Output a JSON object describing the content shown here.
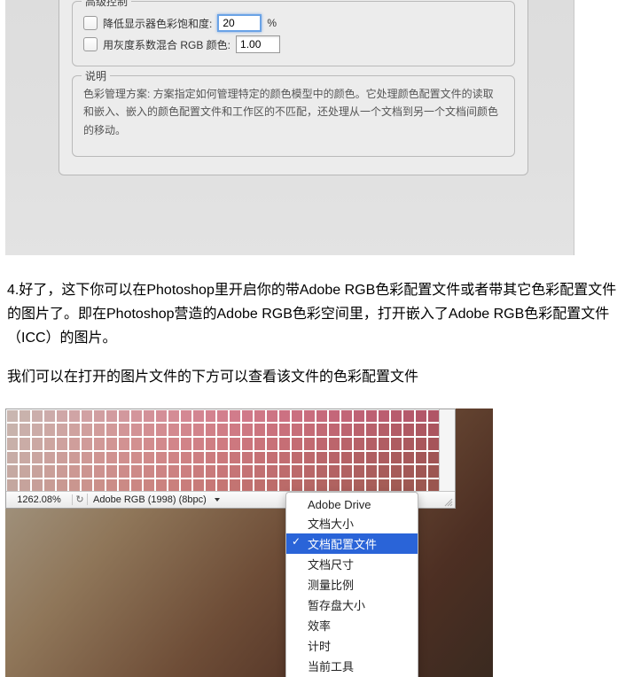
{
  "dialog": {
    "adv_legend": "高级控制",
    "cb1_label": "降低显示器色彩饱和度:",
    "cb1_value": "20",
    "cb1_unit": "%",
    "cb2_label": "用灰度系数混合 RGB 颜色:",
    "cb2_value": "1.00",
    "desc_legend": "说明",
    "desc_text": "色彩管理方案: 方案指定如何管理特定的颜色模型中的颜色。它处理颜色配置文件的读取和嵌入、嵌入的颜色配置文件和工作区的不匹配，还处理从一个文档到另一个文档间颜色的移动。"
  },
  "article": {
    "p1": "4.好了，这下你可以在Photoshop里开启你的带Adobe RGB色彩配置文件或者带其它色彩配置文件的图片了。即在Photoshop营造的Adobe RGB色彩空间里，打开嵌入了Adobe RGB色彩配置文件（ICC）的图片。",
    "p2": "我们可以在打开的图片文件的下方可以查看该文件的色彩配置文件"
  },
  "status": {
    "zoom": "1262.08%",
    "profile": "Adobe RGB (1998) (8bpc)"
  },
  "menu": {
    "items": [
      "Adobe Drive",
      "文档大小",
      "文档配置文件",
      "文档尺寸",
      "测量比例",
      "暂存盘大小",
      "效率",
      "计时",
      "当前工具"
    ],
    "selected_index": 2
  },
  "swatch_colors": [
    [
      "#c9b6b0",
      "#c9b2ac",
      "#cbaeab",
      "#ccabaa",
      "#cfa7a7",
      "#d0a4a5",
      "#d1a1a3",
      "#d19ea1",
      "#d29b9f",
      "#d2989d",
      "#d3959b",
      "#d39199",
      "#d48e97",
      "#d48c95",
      "#d48893",
      "#d38591",
      "#d3828f",
      "#d27f8d",
      "#d17c8b",
      "#d07989",
      "#cf7786",
      "#cd7484",
      "#cc7182",
      "#ca6f80",
      "#c96d7e",
      "#c66a7b",
      "#c46779",
      "#c26577",
      "#bf6275",
      "#bd6072",
      "#bb5e70",
      "#b85c6e",
      "#b5596b",
      "#b35769",
      "#b05566"
    ],
    [
      "#c8b3ac",
      "#caafaa",
      "#cbaba7",
      "#cda8a4",
      "#cea5a2",
      "#cfa29f",
      "#d09f9d",
      "#d19c9b",
      "#d29999",
      "#d29597",
      "#d29295",
      "#d38f93",
      "#d38c91",
      "#d3898f",
      "#d2868d",
      "#d2838b",
      "#d18088",
      "#d07d86",
      "#cf7a84",
      "#cd7882",
      "#cc757f",
      "#ca727d",
      "#c9707b",
      "#c76e79",
      "#c56b76",
      "#c26974",
      "#c06672",
      "#bd6470",
      "#bb626d",
      "#b8606b",
      "#b55e68",
      "#b35b66",
      "#b05963",
      "#ad5761",
      "#ab555f"
    ],
    [
      "#c8b0a9",
      "#caaca6",
      "#cba8a3",
      "#cda5a0",
      "#cea19e",
      "#cf9e9b",
      "#d09b99",
      "#d19897",
      "#d19594",
      "#d29292",
      "#d29090",
      "#d28c8e",
      "#d2898c",
      "#d2868a",
      "#d18388",
      "#d08086",
      "#cf7e83",
      "#cf7b81",
      "#cd787f",
      "#cb757c",
      "#ca737a",
      "#c87178",
      "#c66e75",
      "#c46c73",
      "#c26a71",
      "#bf676f",
      "#bc656c",
      "#b9636a",
      "#b76168",
      "#b45f65",
      "#b15d63",
      "#ae5b61",
      "#ab595e",
      "#a9575c",
      "#a6555a"
    ],
    [
      "#c7aca6",
      "#c9a9a3",
      "#caa5a0",
      "#cba19d",
      "#cc9e9a",
      "#cd9b97",
      "#ce9895",
      "#cf9592",
      "#d09290",
      "#d08f8e",
      "#d08d8c",
      "#d08a8a",
      "#d08788",
      "#cf8486",
      "#ce8183",
      "#cd7e81",
      "#cc7c7f",
      "#cb797c",
      "#c9767a",
      "#c77478",
      "#c67175",
      "#c46f73",
      "#c26d71",
      "#bf6b6e",
      "#bd686c",
      "#ba666a",
      "#b86468",
      "#b56265",
      "#b26063",
      "#af5e61",
      "#ad5c5f",
      "#aa5b5c",
      "#a7595a",
      "#a45758",
      "#a15555"
    ],
    [
      "#c5a9a2",
      "#c7a69f",
      "#c8a29c",
      "#ca9f99",
      "#cb9b96",
      "#cc9893",
      "#cc9591",
      "#cd928f",
      "#cd8f8c",
      "#cd8c8a",
      "#cd8a88",
      "#cd8786",
      "#cd8484",
      "#cc8282",
      "#cc7f80",
      "#ca7c7d",
      "#c97a7b",
      "#c87779",
      "#c67577",
      "#c47274",
      "#c27072",
      "#c06e70",
      "#be6c6d",
      "#bc6a6b",
      "#b96769",
      "#b66566",
      "#b46364",
      "#b16262",
      "#ae6060",
      "#ab5e5d",
      "#a85c5b",
      "#a65b59",
      "#a35957",
      "#a05754",
      "#9d5652"
    ],
    [
      "#c4a79f",
      "#c6a39c",
      "#c79f99",
      "#c89c95",
      "#c99992",
      "#ca968f",
      "#cb938d",
      "#cb908a",
      "#cb8d88",
      "#cb8a85",
      "#cb8783",
      "#cb8581",
      "#cb827f",
      "#ca807d",
      "#c97d7b",
      "#c87b79",
      "#c77877",
      "#c57674",
      "#c37472",
      "#c17170",
      "#bf6f6d",
      "#bd6d6b",
      "#bb6b69",
      "#b96967",
      "#b66765",
      "#b36562",
      "#b06360",
      "#ae615e",
      "#ab605c",
      "#a85e5a",
      "#a55d57",
      "#a25b55",
      "#9f5953",
      "#9c5851",
      "#9a564f"
    ]
  ]
}
